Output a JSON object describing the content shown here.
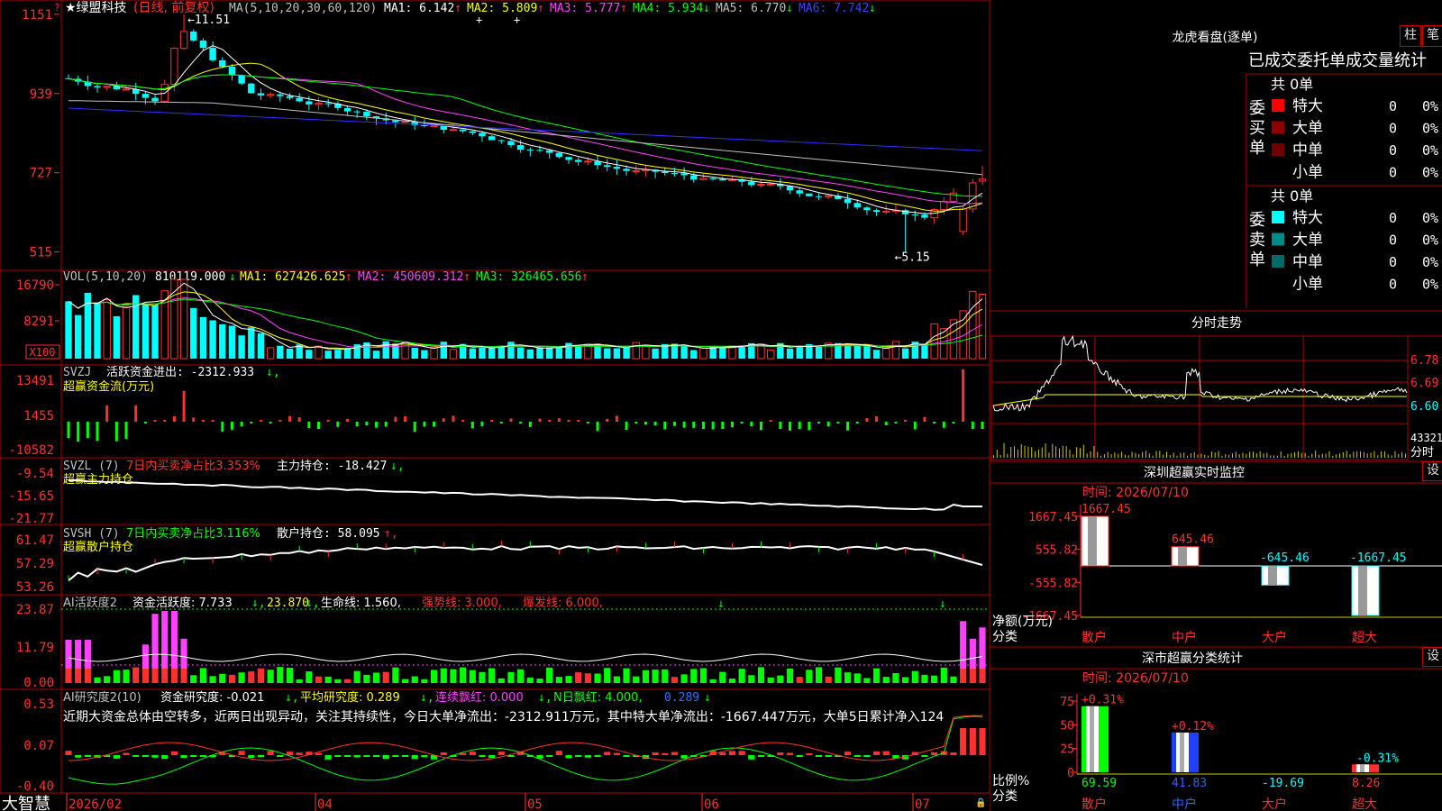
{
  "stock": {
    "title": "★绿盟科技",
    "period": "(日线, 前复权)",
    "ma_label": "MA(5,10,20,30,60,120)",
    "ma_items": [
      {
        "label": "MA1: 6.142",
        "arrow": "↑",
        "color": "#ffffff",
        "arrow_color": "#ff3030"
      },
      {
        "label": "MA2: 5.809",
        "arrow": "↑",
        "color": "#ffff00",
        "arrow_color": "#ff3030"
      },
      {
        "label": "MA3: 5.777",
        "arrow": "↑",
        "color": "#ff40ff",
        "arrow_color": "#ff3030"
      },
      {
        "label": "MA4: 5.934",
        "arrow": "↓",
        "color": "#00ff00",
        "arrow_color": "#00ff00"
      },
      {
        "label": "MA5: 6.770",
        "arrow": "↓",
        "color": "#c0c0c0",
        "arrow_color": "#00ff00"
      },
      {
        "label": "MA6: 7.742",
        "arrow": "↓",
        "color": "#4040ff",
        "arrow_color": "#00ff00"
      }
    ],
    "high_annotation": "11.51",
    "low_annotation": "5.15",
    "price_ticks": [
      "1151",
      "939",
      "727",
      "515"
    ],
    "corner_marker": "?"
  },
  "volume": {
    "label": "VOL(5,10,20)",
    "value": "810119.000",
    "value_arrow": "↓",
    "items": [
      {
        "label": "MA1: 627426.625",
        "arrow": "↑",
        "color": "#ffff00"
      },
      {
        "label": "MA2: 450609.312",
        "arrow": "↑",
        "color": "#ff40ff"
      },
      {
        "label": "MA3: 326465.656",
        "arrow": "↑",
        "color": "#00ff00"
      }
    ],
    "ticks": [
      "16790",
      "8291"
    ],
    "unit": "X100"
  },
  "svzj": {
    "name": "SVZJ",
    "item": "活跃资金进出: -2312.933",
    "arrow": "↓",
    "subtitle": "超赢资金流(万元)",
    "ticks": [
      "13491",
      "1455",
      "-10582"
    ]
  },
  "svzl": {
    "name": "SVZL (7)",
    "ratio": "7日内买卖净占比3.353%",
    "item": "主力持仓: -18.427",
    "arrow": "↓",
    "subtitle": "超赢主力持仓",
    "ticks": [
      "-9.54",
      "-15.65",
      "-21.77"
    ]
  },
  "svsh": {
    "name": "SVSH (7)",
    "ratio": "7日内买卖净占比3.116%",
    "item": "散户持仓: 58.095",
    "arrow": "↑",
    "subtitle": "超赢散户持仓",
    "ticks": [
      "61.47",
      "57.29",
      "53.26"
    ]
  },
  "ai_active": {
    "name": "AI活跃度2",
    "i1": "资金活跃度: 7.733",
    "i1_arrow": "↓",
    "i2": "23.870",
    "i2_arrow": "↓",
    "i3": "生命线: 1.560",
    "i3_arrow": ",",
    "i4": "强势线: 3.000",
    "i5": "爆发线: 6.000",
    "ticks": [
      "23.87",
      "11.79",
      "0.00"
    ]
  },
  "ai_research": {
    "name": "AI研究度2(10)",
    "i1": "资金研究度: -0.021",
    "i1_arrow": "↓",
    "i2": "平均研究度: 0.289",
    "i2_arrow": "↓",
    "i3": "连续飘红: 0.000",
    "i3_arrow": "↓",
    "i4": "N日飘红: 4.000",
    "i5": "0.289",
    "i5_arrow": "↓",
    "commentary": "近期大资金总体由空转多，近两日出现异动，关注其持续性，今日大单净流出：-2312.911万元，其中特大单净流出：-1667.447万元，大单5日累计净入124",
    "ticks": [
      "0.53",
      "0.07",
      "-0.40"
    ]
  },
  "bottom_axis": {
    "brand": "大智慧",
    "months": [
      "2026/02",
      "04",
      "05",
      "06",
      "07"
    ]
  },
  "dragon": {
    "title": "龙虎看盘(逐单)",
    "btn_bar": "柱",
    "btn_pen": "笔",
    "tabs": "已成交委托单成交量统计",
    "buy_total": "共 0单",
    "sell_total": "共 0单",
    "buy_label": "委买单",
    "sell_label": "委卖单",
    "buy_rows": [
      {
        "name": "特大",
        "count": "0",
        "pct": "0%",
        "color": "#ff0000"
      },
      {
        "name": "大单",
        "count": "0",
        "pct": "0%",
        "color": "#900000"
      },
      {
        "name": "中单",
        "count": "0",
        "pct": "0%",
        "color": "#700000"
      },
      {
        "name": "小单",
        "count": "0",
        "pct": "0%",
        "color": ""
      }
    ],
    "sell_rows": [
      {
        "name": "特大",
        "count": "0",
        "pct": "0%",
        "color": "#00ffff"
      },
      {
        "name": "大单",
        "count": "0",
        "pct": "0%",
        "color": "#008b8b"
      },
      {
        "name": "中单",
        "count": "0",
        "pct": "0%",
        "color": "#006b6b"
      },
      {
        "name": "小单",
        "count": "0",
        "pct": "0%",
        "color": ""
      }
    ]
  },
  "intraday": {
    "title": "分时走势",
    "ticks": [
      "6.78",
      "6.69",
      "6.60"
    ],
    "volume_label": "43321",
    "minute_label": "分时"
  },
  "sz_monitor": {
    "title": "深圳超赢实时监控",
    "btn": "设",
    "time": "时间: 2026/07/10",
    "y_ticks": [
      "1667.45",
      "555.82",
      "-555.82",
      "-1667.45"
    ],
    "ylabel": "净额(万元)",
    "xlabel": "分类",
    "categories": [
      "散户",
      "中户",
      "大户",
      "超大"
    ],
    "values": [
      1667.45,
      645.46,
      -645.46,
      -1667.45
    ],
    "value_labels": [
      "1667.45",
      "645.46",
      "-645.46",
      "-1667.45"
    ]
  },
  "sz_class": {
    "title": "深市超赢分类统计",
    "btn": "设",
    "time": "时间: 2026/07/10",
    "y_ticks": [
      "75",
      "50",
      "25",
      "0"
    ],
    "ylabel": "比例%",
    "xlabel": "分类",
    "categories": [
      "散户",
      "中户",
      "大户",
      "超大"
    ],
    "bar_values": [
      69.59,
      41.83,
      0,
      8.26
    ],
    "top_labels": [
      "+0.31%",
      "+0.12%",
      "",
      "-0.31%"
    ],
    "bottom_labels": [
      "69.59",
      "41.83",
      "-19.69",
      "8.26"
    ]
  },
  "chart_data": {
    "type": "candlestick",
    "title": "",
    "price_range": [
      4.9,
      11.7
    ],
    "candles_ohlc_approx": [
      [
        9.85,
        10.1,
        9.7,
        9.75
      ],
      [
        9.8,
        9.95,
        9.5,
        9.6
      ],
      [
        9.55,
        9.8,
        9.4,
        9.7
      ],
      [
        9.6,
        9.7,
        9.2,
        9.3
      ],
      [
        9.3,
        9.4,
        9.0,
        9.1
      ],
      [
        9.1,
        9.6,
        9.0,
        9.5
      ],
      [
        9.55,
        9.7,
        9.25,
        9.35
      ],
      [
        9.3,
        9.45,
        9.1,
        9.2
      ],
      [
        9.2,
        9.7,
        9.15,
        9.6
      ],
      [
        9.6,
        9.9,
        9.4,
        9.5
      ],
      [
        9.5,
        10.1,
        9.4,
        10.0
      ],
      [
        10.0,
        11.51,
        9.9,
        11.0
      ],
      [
        10.9,
        11.2,
        10.3,
        10.4
      ],
      [
        10.4,
        10.6,
        9.95,
        10.05
      ],
      [
        10.0,
        10.1,
        9.7,
        9.8
      ],
      [
        9.8,
        9.9,
        9.6,
        9.7
      ],
      [
        9.7,
        9.95,
        9.6,
        9.85
      ],
      [
        9.8,
        9.9,
        9.5,
        9.55
      ],
      [
        9.5,
        9.7,
        9.3,
        9.35
      ],
      [
        9.3,
        9.4,
        8.9,
        8.95
      ],
      [
        8.95,
        9.2,
        8.8,
        9.1
      ],
      [
        9.05,
        9.1,
        8.75,
        8.8
      ],
      [
        8.8,
        9.0,
        8.6,
        8.65
      ],
      [
        8.7,
        8.8,
        8.5,
        8.55
      ],
      [
        8.55,
        8.65,
        8.3,
        8.35
      ],
      [
        8.35,
        8.45,
        8.1,
        8.15
      ],
      [
        8.15,
        8.25,
        7.95,
        8.0
      ],
      [
        8.05,
        8.3,
        8.0,
        8.25
      ],
      [
        8.25,
        8.35,
        8.1,
        8.15
      ],
      [
        8.1,
        8.2,
        7.95,
        8.05
      ]
    ]
  }
}
